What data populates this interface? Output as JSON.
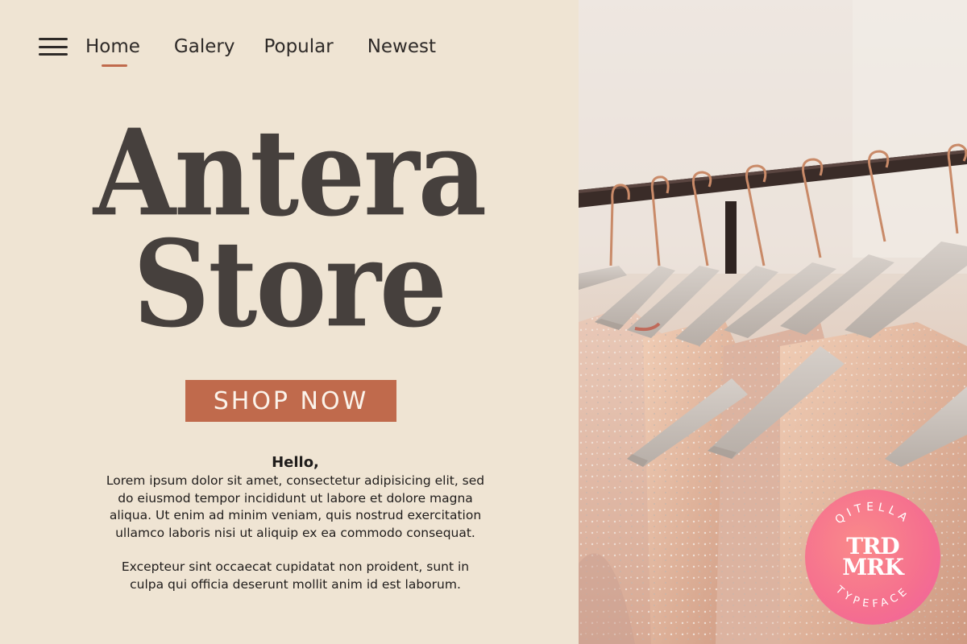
{
  "nav": {
    "links": [
      "Home",
      "Galery",
      "Popular",
      "Newest"
    ],
    "active": "Home"
  },
  "hero": {
    "title_line1": "Antera",
    "title_line2": "Store",
    "cta": "SHOP NOW"
  },
  "copy": {
    "greeting": "Hello,",
    "paragraph1": "Lorem ipsum dolor sit amet, consectetur adipisicing elit, sed do eiusmod tempor incididunt ut labore et dolore magna aliqua. Ut enim ad minim veniam, quis nostrud exercitation ullamco laboris nisi ut aliquip ex ea commodo consequat.",
    "paragraph2": "Excepteur sint occaecat cupidatat non proident, sunt in culpa qui officia deserunt mollit anim id est laborum."
  },
  "badge": {
    "ring_top": "QITELLA",
    "ring_bottom": "TYPEFACE",
    "center_line1": "TRD",
    "center_line2": "MRK"
  },
  "colors": {
    "background": "#efe4d3",
    "accent": "#c06a4c",
    "title": "#46403d",
    "badge": "#f56f8f"
  }
}
